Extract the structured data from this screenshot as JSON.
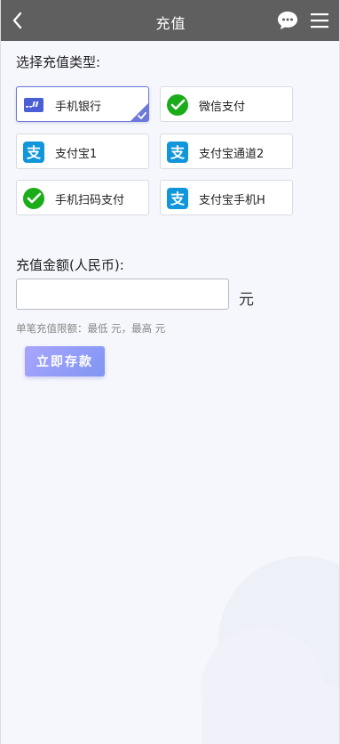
{
  "header": {
    "title": "充值",
    "back_icon": "chevron-left-icon",
    "chat_icon": "chat-bubble-icon",
    "menu_icon": "hamburger-menu-icon"
  },
  "payment": {
    "section_label": "选择充值类型:",
    "options": [
      {
        "label": "手机银行",
        "icon": "bank-card-icon",
        "selected": true
      },
      {
        "label": "微信支付",
        "icon": "wechat-pay-icon",
        "selected": false
      },
      {
        "label": "支付宝1",
        "icon": "alipay-icon",
        "selected": false
      },
      {
        "label": "支付宝通道2",
        "icon": "alipay-icon",
        "selected": false
      },
      {
        "label": "手机扫码支付",
        "icon": "wechat-pay-icon",
        "selected": false
      },
      {
        "label": "支付宝手机H",
        "icon": "alipay-icon",
        "selected": false
      }
    ]
  },
  "amount": {
    "label": "充值金额(人民币):",
    "value": "",
    "placeholder": "",
    "unit": "元",
    "limit_text": "单笔充值限额：最低 元，最高 元"
  },
  "submit": {
    "label": "立即存款"
  },
  "colors": {
    "header_bg": "#5f5f5f",
    "page_bg": "#f6f7fc",
    "selected_border": "#6c79d9",
    "wechat_green": "#1aad19",
    "alipay_blue": "#1296db",
    "button_gradient_start": "#a9a5ff",
    "button_gradient_end": "#7f96f2"
  }
}
